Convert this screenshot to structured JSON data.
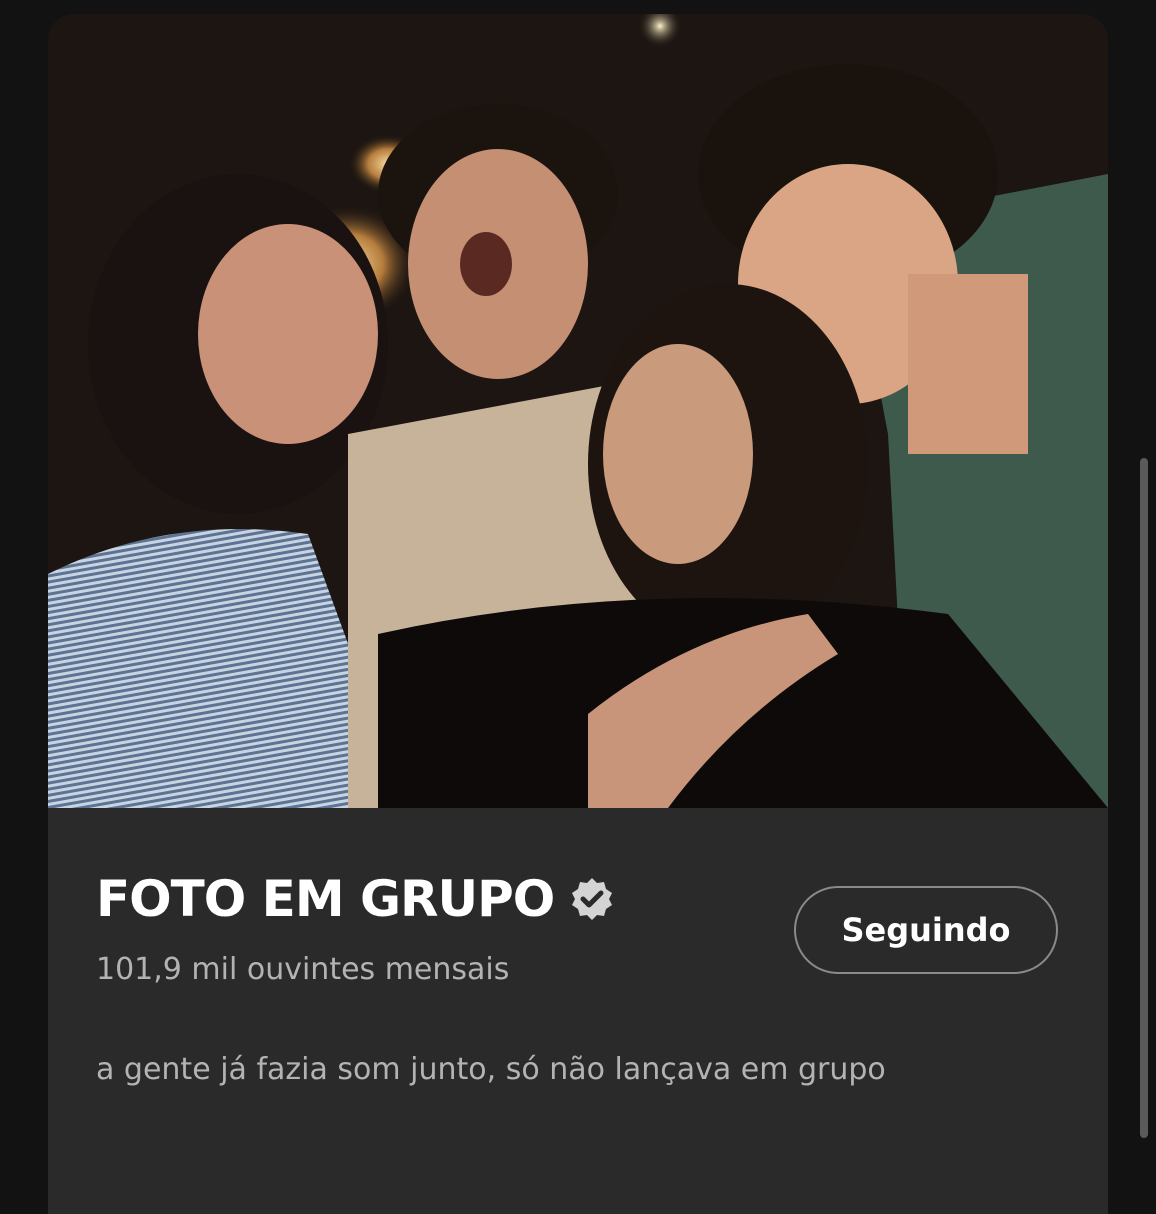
{
  "artist": {
    "name": "FOTO EM GRUPO",
    "verified_icon": "verified-badge-icon",
    "monthly_listeners": "101,9 mil ouvintes mensais",
    "follow_label": "Seguindo",
    "bio": "a gente já fazia som junto, só não lançava em grupo"
  },
  "photo": {
    "description_icon": "artist-photo"
  },
  "colors": {
    "background": "#121212",
    "card": "#2a2a2a",
    "primary_text": "#ffffff",
    "secondary_text": "#b3b3b3"
  }
}
